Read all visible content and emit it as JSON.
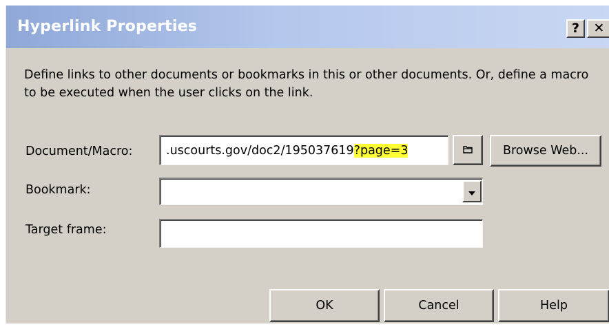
{
  "window": {
    "title": "Hyperlink Properties",
    "help_button": "?",
    "close_button": "✕"
  },
  "description": "Define links to other documents or bookmarks in this or other documents. Or, define a macro to be executed when the user clicks on the link.",
  "fields": {
    "document_macro": {
      "label": "Document/Macro:",
      "value_prefix": ".uscourts.gov/doc2/195037619",
      "value_highlight": "?page=3",
      "highlight_color": "#ffff33"
    },
    "bookmark": {
      "label": "Bookmark:",
      "value": ""
    },
    "target_frame": {
      "label": "Target frame:",
      "value": ""
    }
  },
  "buttons": {
    "browse_web": "Browse Web...",
    "ok": "OK",
    "cancel": "Cancel",
    "help": "Help"
  },
  "icons": {
    "browse_file": "folder-icon",
    "dropdown": "chevron-down-icon"
  },
  "colors": {
    "dialog_bg": "#d4d0c8",
    "title_gradient_start": "#8fa8d8",
    "title_gradient_end": "#c9d7f2",
    "title_text": "#ffffff"
  }
}
